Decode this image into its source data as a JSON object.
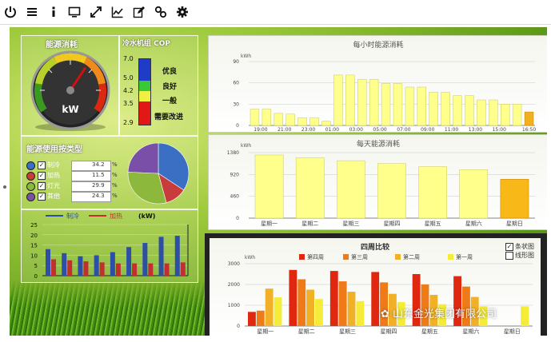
{
  "toolbar": {
    "icons": [
      "power-icon",
      "menu-icon",
      "info-icon",
      "monitor-icon",
      "expand-icon",
      "line-chart-icon",
      "edit-icon",
      "link-icon",
      "gear-icon"
    ]
  },
  "gauge": {
    "title": "能源消耗",
    "unit": "kW",
    "value_fraction": 0.62
  },
  "cop": {
    "title": "冷水机组 COP",
    "scale": [
      "7.0",
      "5.0",
      "4.2",
      "3.5",
      "2.9"
    ],
    "levels": [
      "优良",
      "良好",
      "一般",
      "需要改进"
    ],
    "colors": [
      "#1e3cc8",
      "#38c838",
      "#f0f040",
      "#e01818"
    ]
  },
  "energy_types": {
    "title": "能源使用按类型",
    "unit": "%",
    "rows": [
      {
        "label": "制冷",
        "value": "34.2",
        "color": "#3a6fc4"
      },
      {
        "label": "加热",
        "value": "11.5",
        "color": "#c83c3c"
      },
      {
        "label": "灯光",
        "value": "29.9",
        "color": "#8cb83c"
      },
      {
        "label": "其他",
        "value": "24.3",
        "color": "#7a4fa8"
      }
    ]
  },
  "mini_chart": {
    "legend_cooling": "制冷",
    "legend_heating": "加热",
    "unit": "(kW)",
    "ticks": [
      "25",
      "20",
      "15",
      "10",
      "5",
      "0"
    ]
  },
  "hourly": {
    "title": "每小时能源消耗",
    "unit": "kWh"
  },
  "daily": {
    "title": "每天能源消耗",
    "unit": "kWh"
  },
  "weekly": {
    "title": "四周比较",
    "unit": "kWh",
    "options": [
      "条状图",
      "线形图"
    ]
  },
  "watermark": "山东金光集团有限公司",
  "chart_data": [
    {
      "type": "bar",
      "title": "",
      "series": [
        {
          "name": "制冷",
          "values": [
            13,
            11,
            9.5,
            10,
            11.5,
            14,
            16,
            19,
            19.5
          ]
        },
        {
          "name": "加热",
          "values": [
            8,
            7.5,
            7,
            6.5,
            6,
            6,
            6,
            6,
            6.5
          ]
        }
      ],
      "ylim": [
        0,
        25
      ],
      "yticks": [
        0,
        5,
        10,
        15,
        20,
        25
      ],
      "grid": true
    },
    {
      "type": "bar",
      "title": "每小时能源消耗",
      "ylabel": "kWh",
      "tick_labels": [
        "19:00",
        "21:00",
        "23:00",
        "01:00",
        "03:00",
        "05:00",
        "07:00",
        "09:00",
        "11:00",
        "13:00",
        "15:00",
        "16:50"
      ],
      "values": [
        23,
        23,
        17,
        16,
        11,
        11,
        6,
        71,
        71,
        65,
        65,
        59,
        59,
        54,
        54,
        47,
        47,
        42,
        42,
        36,
        36,
        30,
        30,
        19
      ],
      "ylim": [
        0,
        90
      ],
      "yticks": [
        0,
        30,
        60,
        90
      ],
      "grid": true,
      "highlight_last": true
    },
    {
      "type": "bar",
      "title": "每天能源消耗",
      "ylabel": "kWh",
      "categories": [
        "星期一",
        "星期二",
        "星期三",
        "星期四",
        "星期五",
        "星期六",
        "星期日"
      ],
      "values": [
        1330,
        1270,
        1210,
        1150,
        1085,
        1020,
        820
      ],
      "ylim": [
        0,
        1380
      ],
      "yticks": [
        0,
        460,
        920,
        1380
      ],
      "grid": true,
      "highlight_last": true
    },
    {
      "type": "bar",
      "title": "四周比较",
      "ylabel": "kWh",
      "categories": [
        "星期一",
        "星期二",
        "星期三",
        "星期四",
        "星期五",
        "星期六",
        "星期日"
      ],
      "series": [
        {
          "name": "第四周",
          "color": "#e02810",
          "values": [
            680,
            2700,
            2650,
            2600,
            2500,
            2400,
            0
          ]
        },
        {
          "name": "第三周",
          "color": "#ee7a18",
          "values": [
            740,
            2250,
            2150,
            2100,
            2000,
            1900,
            0
          ]
        },
        {
          "name": "第二周",
          "color": "#f0b028",
          "values": [
            1800,
            1750,
            1650,
            1550,
            1500,
            1400,
            0
          ]
        },
        {
          "name": "第一周",
          "color": "#f4ec38",
          "values": [
            1380,
            1300,
            1200,
            1150,
            1050,
            950,
            950
          ]
        }
      ],
      "ylim": [
        0,
        3000
      ],
      "yticks": [
        0,
        1000,
        2000,
        3000
      ],
      "grid": true,
      "legend": "top"
    },
    {
      "type": "pie",
      "title": "能源使用按类型",
      "categories": [
        "制冷",
        "加热",
        "灯光",
        "其他"
      ],
      "values": [
        34.2,
        11.5,
        29.9,
        24.3
      ]
    }
  ]
}
